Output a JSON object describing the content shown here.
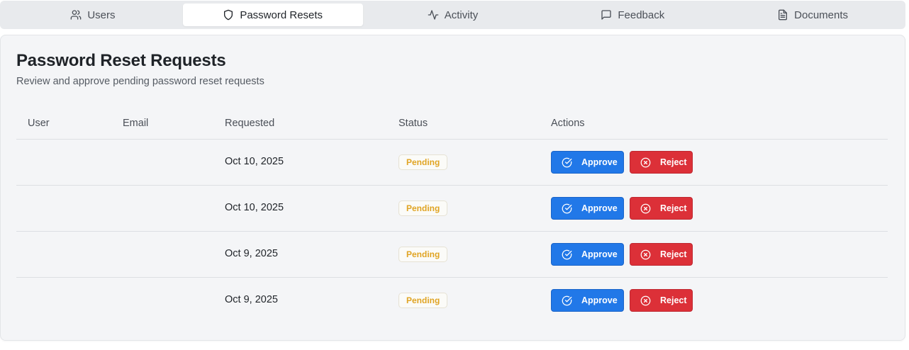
{
  "tabs": [
    {
      "label": "Users",
      "icon": "users-icon",
      "active": false
    },
    {
      "label": "Password Resets",
      "icon": "shield-icon",
      "active": true
    },
    {
      "label": "Activity",
      "icon": "activity-icon",
      "active": false
    },
    {
      "label": "Feedback",
      "icon": "message-square-icon",
      "active": false
    },
    {
      "label": "Documents",
      "icon": "file-text-icon",
      "active": false
    }
  ],
  "page": {
    "title": "Password Reset Requests",
    "subtitle": "Review and approve pending password reset requests"
  },
  "table": {
    "columns": [
      "User",
      "Email",
      "Requested",
      "Status",
      "Actions"
    ],
    "rows": [
      {
        "user": "",
        "email": "",
        "requested": "Oct 10, 2025",
        "status": "Pending"
      },
      {
        "user": "",
        "email": "",
        "requested": "Oct 10, 2025",
        "status": "Pending"
      },
      {
        "user": "",
        "email": "",
        "requested": "Oct 9, 2025",
        "status": "Pending"
      },
      {
        "user": "",
        "email": "",
        "requested": "Oct 9, 2025",
        "status": "Pending"
      }
    ],
    "approve_label": "Approve",
    "reject_label": "Reject"
  },
  "colors": {
    "approve": "#2178e8",
    "reject": "#dc3038",
    "pending": "#e0a423"
  }
}
